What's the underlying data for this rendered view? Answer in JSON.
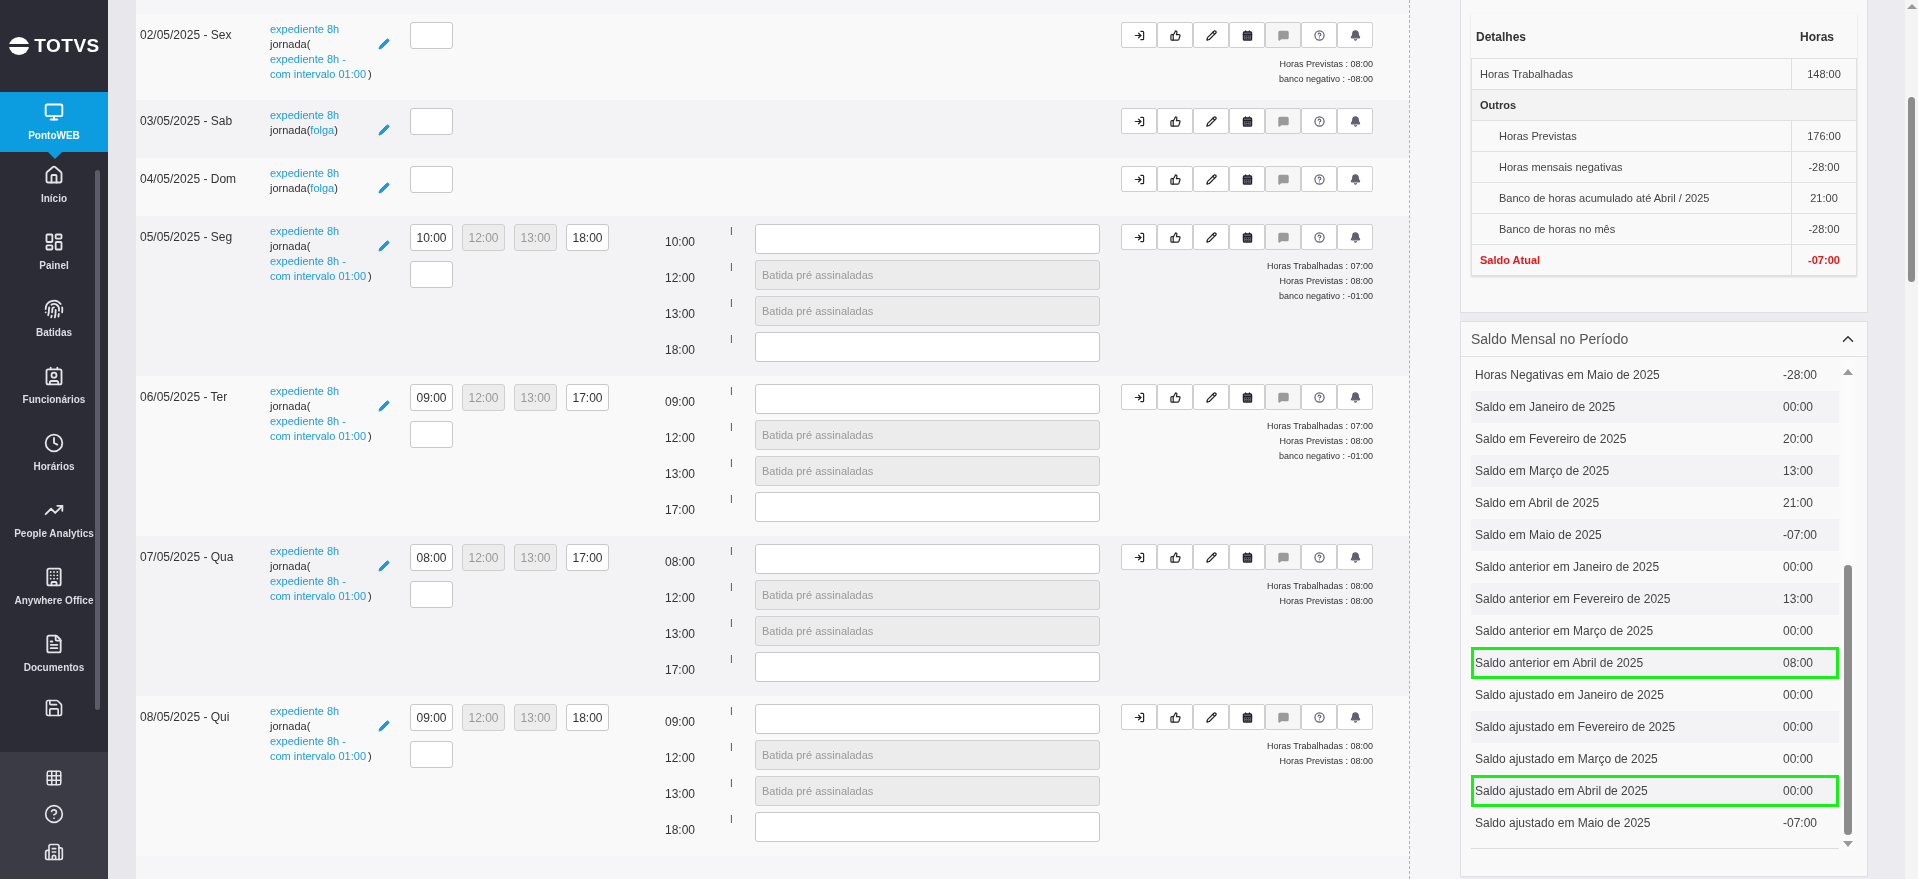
{
  "sidebar": {
    "logo": "TOTVS",
    "items": [
      {
        "label": "PontoWEB",
        "selected": true
      },
      {
        "label": "Início",
        "selected": false
      },
      {
        "label": "Painel",
        "selected": false
      },
      {
        "label": "Batidas",
        "selected": false
      },
      {
        "label": "Funcionários",
        "selected": false
      },
      {
        "label": "Horários",
        "selected": false
      },
      {
        "label": "People Analytics",
        "selected": false
      },
      {
        "label": "Anywhere Office",
        "selected": false
      },
      {
        "label": "Documentos",
        "selected": false
      }
    ]
  },
  "action_buttons": [
    {
      "disabled": false
    },
    {
      "disabled": false
    },
    {
      "disabled": false
    },
    {
      "disabled": false
    },
    {
      "disabled": true
    },
    {
      "disabled": false
    },
    {
      "disabled": false
    }
  ],
  "days": [
    {
      "date": "02/05/2025 - Sex",
      "schedule": "expediente 8h",
      "jornada_prefix": "jornada(",
      "jornada_link": "expediente 8h - com intervalo 01:00",
      "jornada_suffix": ")",
      "planned": [
        {
          "disabled": false
        }
      ],
      "summary": [
        "Horas Previstas : 08:00",
        "banco negativo : -08:00"
      ]
    },
    {
      "date": "03/05/2025 - Sab",
      "schedule": "expediente 8h",
      "jornada_prefix": "jornada(",
      "jornada_link": "folga",
      "jornada_suffix": ")",
      "planned": [
        {
          "disabled": false
        }
      ]
    },
    {
      "date": "04/05/2025 - Dom",
      "schedule": "expediente 8h",
      "jornada_prefix": "jornada(",
      "jornada_link": "folga",
      "jornada_suffix": ")",
      "planned": [
        {
          "disabled": false
        }
      ]
    },
    {
      "date": "05/05/2025 - Seg",
      "schedule": "expediente 8h",
      "jornada_prefix": "jornada(",
      "jornada_link": "expediente 8h - com intervalo 01:00",
      "jornada_suffix": ")",
      "planned": [
        {
          "value": "10:00",
          "disabled": false
        },
        {
          "value": "12:00",
          "disabled": true
        },
        {
          "value": "13:00",
          "disabled": true
        },
        {
          "value": "18:00",
          "disabled": false
        },
        {
          "disabled": false
        }
      ],
      "punches": [
        {
          "time": "10:00",
          "marker": "I",
          "disabled": false
        },
        {
          "time": "12:00",
          "marker": "I",
          "disabled": true,
          "placeholder": "Batida pré assinaladas"
        },
        {
          "time": "13:00",
          "marker": "I",
          "disabled": true,
          "placeholder": "Batida pré assinaladas"
        },
        {
          "time": "18:00",
          "marker": "I",
          "disabled": false
        }
      ],
      "summary": [
        "Horas Trabalhadas : 07:00",
        "Horas Previstas : 08:00",
        "banco negativo : -01:00"
      ]
    },
    {
      "date": "06/05/2025 - Ter",
      "schedule": "expediente 8h",
      "jornada_prefix": "jornada(",
      "jornada_link": "expediente 8h - com intervalo 01:00",
      "jornada_suffix": ")",
      "planned": [
        {
          "value": "09:00",
          "disabled": false
        },
        {
          "value": "12:00",
          "disabled": true
        },
        {
          "value": "13:00",
          "disabled": true
        },
        {
          "value": "17:00",
          "disabled": false
        },
        {
          "disabled": false
        }
      ],
      "punches": [
        {
          "time": "09:00",
          "marker": "I",
          "disabled": false
        },
        {
          "time": "12:00",
          "marker": "I",
          "disabled": true,
          "placeholder": "Batida pré assinaladas"
        },
        {
          "time": "13:00",
          "marker": "I",
          "disabled": true,
          "placeholder": "Batida pré assinaladas"
        },
        {
          "time": "17:00",
          "marker": "I",
          "disabled": false
        }
      ],
      "summary": [
        "Horas Trabalhadas : 07:00",
        "Horas Previstas : 08:00",
        "banco negativo : -01:00"
      ]
    },
    {
      "date": "07/05/2025 - Qua",
      "schedule": "expediente 8h",
      "jornada_prefix": "jornada(",
      "jornada_link": "expediente 8h - com intervalo 01:00",
      "jornada_suffix": ")",
      "planned": [
        {
          "value": "08:00",
          "disabled": false
        },
        {
          "value": "12:00",
          "disabled": true
        },
        {
          "value": "13:00",
          "disabled": true
        },
        {
          "value": "17:00",
          "disabled": false
        },
        {
          "disabled": false
        }
      ],
      "punches": [
        {
          "time": "08:00",
          "marker": "I",
          "disabled": false
        },
        {
          "time": "12:00",
          "marker": "I",
          "disabled": true,
          "placeholder": "Batida pré assinaladas"
        },
        {
          "time": "13:00",
          "marker": "I",
          "disabled": true,
          "placeholder": "Batida pré assinaladas"
        },
        {
          "time": "17:00",
          "marker": "I",
          "disabled": false
        }
      ],
      "summary": [
        "Horas Trabalhadas : 08:00",
        "Horas Previstas : 08:00"
      ]
    },
    {
      "date": "08/05/2025 - Qui",
      "schedule": "expediente 8h",
      "jornada_prefix": "jornada(",
      "jornada_link": "expediente 8h - com intervalo 01:00",
      "jornada_suffix": ")",
      "planned": [
        {
          "value": "09:00",
          "disabled": false
        },
        {
          "value": "12:00",
          "disabled": true
        },
        {
          "value": "13:00",
          "disabled": true
        },
        {
          "value": "18:00",
          "disabled": false
        },
        {
          "disabled": false
        }
      ],
      "punches": [
        {
          "time": "09:00",
          "marker": "I",
          "disabled": false
        },
        {
          "time": "12:00",
          "marker": "I",
          "disabled": true,
          "placeholder": "Batida pré assinaladas"
        },
        {
          "time": "13:00",
          "marker": "I",
          "disabled": true,
          "placeholder": "Batida pré assinaladas"
        },
        {
          "time": "18:00",
          "marker": "I",
          "disabled": false
        }
      ],
      "summary": [
        "Horas Trabalhadas : 08:00",
        "Horas Previstas : 08:00"
      ]
    }
  ],
  "details": {
    "headers": [
      "Detalhes",
      "Horas"
    ],
    "rows": [
      {
        "kind": "item",
        "label": "Horas Trabalhadas",
        "value": "148:00"
      },
      {
        "kind": "group",
        "label": "Outros"
      },
      {
        "kind": "subitem",
        "label": "Horas Previstas",
        "value": "176:00"
      },
      {
        "kind": "subitem",
        "label": "Horas mensais negativas",
        "value": "-28:00"
      },
      {
        "kind": "subitem",
        "label": "Banco de horas acumulado até Abril / 2025",
        "value": "21:00"
      },
      {
        "kind": "subitem",
        "label": "Banco de horas no mês",
        "value": "-28:00"
      },
      {
        "kind": "total",
        "label": "Saldo Atual",
        "value": "-07:00"
      }
    ]
  },
  "monthly": {
    "title": "Saldo Mensal no Período",
    "expanded": true,
    "rows": [
      {
        "label": "Horas Negativas em Maio de 2025",
        "value": "-28:00",
        "highlighted": false
      },
      {
        "label": "Saldo em Janeiro de 2025",
        "value": "00:00",
        "highlighted": false
      },
      {
        "label": "Saldo em Fevereiro de 2025",
        "value": "20:00",
        "highlighted": false
      },
      {
        "label": "Saldo em Março de 2025",
        "value": "13:00",
        "highlighted": false
      },
      {
        "label": "Saldo em Abril de 2025",
        "value": "21:00",
        "highlighted": false
      },
      {
        "label": "Saldo em Maio de 2025",
        "value": "-07:00",
        "highlighted": false
      },
      {
        "label": "Saldo anterior em Janeiro de 2025",
        "value": "00:00",
        "highlighted": false
      },
      {
        "label": "Saldo anterior em Fevereiro de 2025",
        "value": "13:00",
        "highlighted": false
      },
      {
        "label": "Saldo anterior em Março de 2025",
        "value": "00:00",
        "highlighted": false
      },
      {
        "label": "Saldo anterior em Abril de 2025",
        "value": "08:00",
        "highlighted": true
      },
      {
        "label": "Saldo ajustado em Janeiro de 2025",
        "value": "00:00",
        "highlighted": false
      },
      {
        "label": "Saldo ajustado em Fevereiro de 2025",
        "value": "00:00",
        "highlighted": false
      },
      {
        "label": "Saldo ajustado em Março de 2025",
        "value": "00:00",
        "highlighted": false
      },
      {
        "label": "Saldo ajustado em Abril de 2025",
        "value": "00:00",
        "highlighted": true
      },
      {
        "label": "Saldo ajustado em Maio de 2025",
        "value": "-07:00",
        "highlighted": false
      }
    ]
  }
}
